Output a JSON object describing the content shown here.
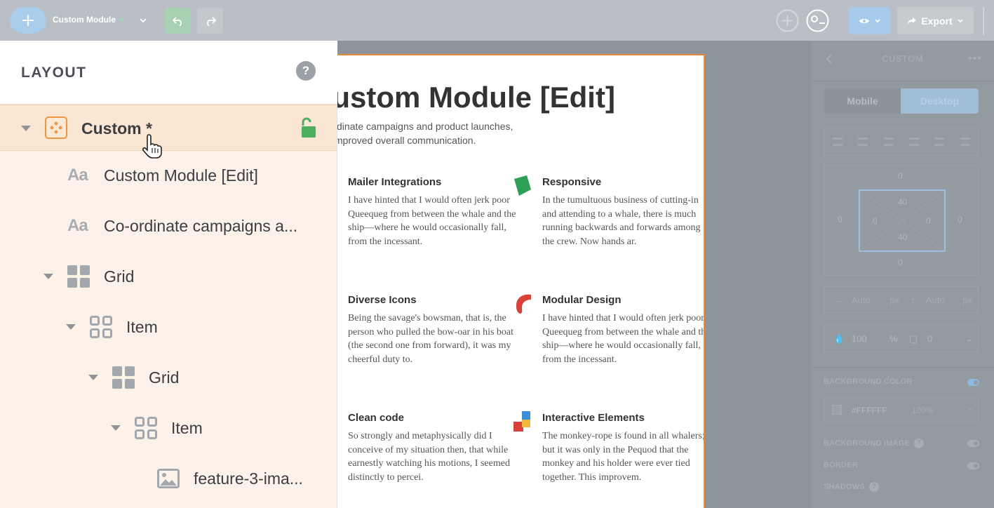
{
  "topbar": {
    "module_name": "Custom Module",
    "export_label": "Export",
    "colors": {
      "accent": "#a9cdea",
      "undo": "#a8d2b3",
      "status_dot": "#9fd8b0"
    }
  },
  "layout_panel": {
    "title": "LAYOUT",
    "help_label": "?",
    "tree": [
      {
        "label": "Custom *",
        "icon": "custom-module-icon",
        "selected": true
      },
      {
        "label": "Custom Module [Edit]",
        "icon": "text-icon"
      },
      {
        "label": "Co-ordinate campaigns a...",
        "icon": "text-icon"
      },
      {
        "label": "Grid",
        "icon": "grid-icon"
      },
      {
        "label": "Item",
        "icon": "grid-outline-icon"
      },
      {
        "label": "Grid",
        "icon": "grid-icon"
      },
      {
        "label": "Item",
        "icon": "grid-outline-icon"
      },
      {
        "label": "feature-3-ima...",
        "icon": "image-icon"
      }
    ],
    "text_icon_glyph": "Aa"
  },
  "canvas": {
    "title": "Custom Module [Edit]",
    "subtitle_line1": "Co-ordinate campaigns and product launches,",
    "subtitle_line2": "with improved overall communication.",
    "features": [
      {
        "title": "Mailer Integrations",
        "text": "I have hinted that I would often jerk poor Queequeg from between the whale and the ship—where he would occasionally fall, from the incessant."
      },
      {
        "title": "Responsive",
        "text": "In the tumultuous business of cutting-in and attending to a whale, there is much running backwards and forwards among the crew. Now hands ar."
      },
      {
        "title": "Diverse Icons",
        "text": "Being the savage's bowsman, that is, the person who pulled the bow-oar in his boat (the second one from forward), it was my cheerful duty to."
      },
      {
        "title": "Modular Design",
        "text": "I have hinted that I would often jerk poor Queequeg from between the whale and the ship—where he would occasionally fall, from the incessant."
      },
      {
        "title": "Clean code",
        "text": "So strongly and metaphysically did I conceive of my situation then, that while earnestly watching his motions, I seemed distinctly to percei."
      },
      {
        "title": "Interactive Elements",
        "text": "The monkey-rope is found in all whalers; but it was only in the Pequod that the monkey and his holder were ever tied together. This improvem."
      }
    ]
  },
  "right_panel": {
    "title": "CUSTOM",
    "tabs": {
      "mobile": "Mobile",
      "desktop": "Desktop"
    },
    "spacing": {
      "margin_top": "0",
      "margin_right": "0",
      "margin_bottom": "0",
      "margin_left": "0",
      "padding_top": "40",
      "padding_right": "0",
      "padding_bottom": "40",
      "padding_left": "0"
    },
    "width_value": "Auto",
    "width_unit": "px",
    "height_value": "Auto",
    "height_unit": "px",
    "opacity_value": "100",
    "opacity_unit": "%",
    "radius_value": "0",
    "background_color_label": "BACKGROUND COLOR",
    "background_color_value": "#FFFFFF",
    "background_color_opacity": "100%",
    "background_image_label": "BACKGROUND IMAGE",
    "border_label": "BORDER",
    "shadows_label": "SHADOWS",
    "help_glyph": "?"
  }
}
